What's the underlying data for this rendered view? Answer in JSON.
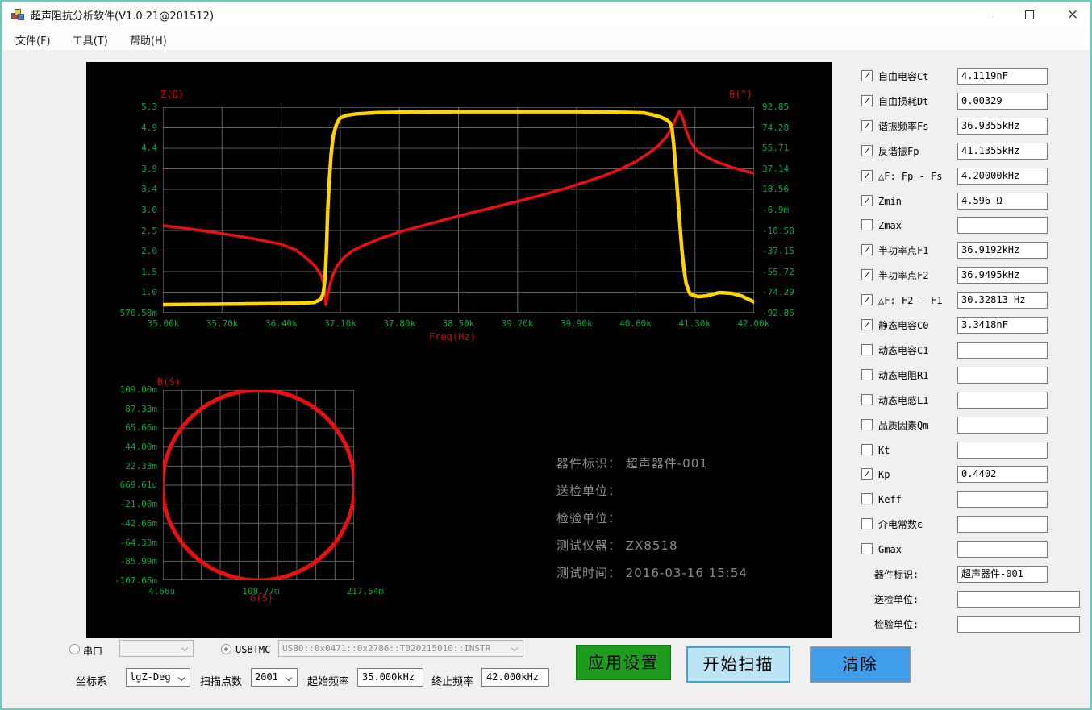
{
  "window": {
    "title": "超声阻抗分析软件(V1.0.21@201512)"
  },
  "menu": [
    "文件(F)",
    "工具(T)",
    "帮助(H)"
  ],
  "colors": {
    "window_border": "#5fcfbe",
    "curve_red": "#e81010",
    "curve_yellow": "#ffd400",
    "tick_green": "#00a83e",
    "axis_label_red": "#d40000",
    "grid_gray": "#606060",
    "button_green": "#1d9b1d",
    "button_light_blue": "#bde4f5",
    "button_blue": "#3f9de9",
    "overlay_gray": "#8c8c8c"
  },
  "results": {
    "rows": [
      {
        "label": "自由电容Ct",
        "value": "4.1119nF",
        "checked": true
      },
      {
        "label": "自由损耗Dt",
        "value": "0.00329",
        "checked": true
      },
      {
        "label": "谐振频率Fs",
        "value": "36.9355kHz",
        "checked": true
      },
      {
        "label": "反谐振Fp",
        "value": "41.1355kHz",
        "checked": true
      },
      {
        "label": "△F: Fp - Fs",
        "value": "4.20000kHz",
        "checked": true
      },
      {
        "label": "Zmin",
        "value": "4.596 Ω",
        "checked": true
      },
      {
        "label": "Zmax",
        "value": "",
        "checked": false
      },
      {
        "label": "半功率点F1",
        "value": "36.9192kHz",
        "checked": true
      },
      {
        "label": "半功率点F2",
        "value": "36.9495kHz",
        "checked": true
      },
      {
        "label": "△F: F2 - F1",
        "value": "30.32813 Hz",
        "checked": true
      },
      {
        "label": "静态电容C0",
        "value": "3.3418nF",
        "checked": true
      },
      {
        "label": "动态电容C1",
        "value": "",
        "checked": false
      },
      {
        "label": "动态电阻R1",
        "value": "",
        "checked": false
      },
      {
        "label": "动态电感L1",
        "value": "",
        "checked": false
      },
      {
        "label": "品质因素Qm",
        "value": "",
        "checked": false
      },
      {
        "label": "Kt",
        "value": "",
        "checked": false
      },
      {
        "label": "Kp",
        "value": "0.4402",
        "checked": true
      },
      {
        "label": "Keff",
        "value": "",
        "checked": false
      },
      {
        "label": "介电常数ε",
        "value": "",
        "checked": false
      },
      {
        "label": "Gmax",
        "value": "",
        "checked": false
      }
    ],
    "device_rows": [
      {
        "label": "器件标识:",
        "value": "超声器件-001",
        "wide": false
      },
      {
        "label": "送检单位:",
        "value": "",
        "wide": true
      },
      {
        "label": "检验单位:",
        "value": "",
        "wide": true
      }
    ]
  },
  "overlay": {
    "lines": [
      "器件标识： 超声器件-001",
      "送检单位：",
      "检验单位：",
      "测试仪器： ZX8518",
      "测试时间： 2016-03-16 15:54"
    ]
  },
  "connection": {
    "serial_label": "串口",
    "serial_selected": false,
    "serial_value": "",
    "usbtmc_label": "USBTMC",
    "usbtmc_selected": true,
    "usbtmc_value": "USB0::0x0471::0x2786::T020215010::INSTR"
  },
  "sweep": {
    "coord_label": "坐标系",
    "coord_value": "lgZ-Deg",
    "points_label": "扫描点数",
    "points_value": "2001",
    "start_label": "起始频率",
    "start_value": "35.000kHz",
    "stop_label": "终止频率",
    "stop_value": "42.000kHz"
  },
  "buttons": {
    "apply": "应用设置",
    "start": "开始扫描",
    "clear": "清除"
  },
  "chart_data": [
    {
      "type": "line",
      "title": "Impedance magnitude and phase vs frequency",
      "xlabel": "Freq(Hz)",
      "ylabel_left": "Z(Ω)",
      "ylabel_right": "θ(°)",
      "x_ticks": [
        "35.00k",
        "35.70k",
        "36.40k",
        "37.10k",
        "37.80k",
        "38.50k",
        "39.20k",
        "39.90k",
        "40.60k",
        "41.30k",
        "42.00k"
      ],
      "y_ticks_left": [
        "5.3",
        "4.9",
        "4.4",
        "3.9",
        "3.4",
        "3.0",
        "2.5",
        "2.0",
        "1.5",
        "1.0",
        "570.58m"
      ],
      "y_ticks_right": [
        "92.85",
        "74.28",
        "55.71",
        "37.14",
        "18.56",
        "-6.9m",
        "-18.58",
        "-37.15",
        "-55.72",
        "-74.29",
        "-92.86"
      ],
      "grid": true,
      "note": "points are [x,y] fractions of plot area, y measured downward; Z dip at Fs=36.9355kHz, peak at Fp=41.1355kHz",
      "series": [
        {
          "name": "Z",
          "color": "#e81010",
          "points": [
            [
              0,
              0.576
            ],
            [
              0.05,
              0.594
            ],
            [
              0.101,
              0.615
            ],
            [
              0.15,
              0.638
            ],
            [
              0.2,
              0.667
            ],
            [
              0.225,
              0.695
            ],
            [
              0.242,
              0.733
            ],
            [
              0.258,
              0.775
            ],
            [
              0.268,
              0.82
            ],
            [
              0.2735,
              0.88
            ],
            [
              0.2754,
              0.961
            ],
            [
              0.278,
              0.92
            ],
            [
              0.282,
              0.87
            ],
            [
              0.2875,
              0.815
            ],
            [
              0.295,
              0.77
            ],
            [
              0.305,
              0.735
            ],
            [
              0.32,
              0.7
            ],
            [
              0.34,
              0.672
            ],
            [
              0.37,
              0.636
            ],
            [
              0.4,
              0.607
            ],
            [
              0.44,
              0.576
            ],
            [
              0.48,
              0.545
            ],
            [
              0.52,
              0.515
            ],
            [
              0.56,
              0.487
            ],
            [
              0.6,
              0.458
            ],
            [
              0.64,
              0.428
            ],
            [
              0.68,
              0.396
            ],
            [
              0.71,
              0.368
            ],
            [
              0.745,
              0.335
            ],
            [
              0.775,
              0.3
            ],
            [
              0.8,
              0.264
            ],
            [
              0.82,
              0.227
            ],
            [
              0.838,
              0.188
            ],
            [
              0.852,
              0.143
            ],
            [
              0.862,
              0.092
            ],
            [
              0.869,
              0.048
            ],
            [
              0.874,
              0.0196
            ],
            [
              0.879,
              0.05
            ],
            [
              0.885,
              0.113
            ],
            [
              0.8925,
              0.168
            ],
            [
              0.9,
              0.2
            ],
            [
              0.906,
              0.218
            ],
            [
              0.92,
              0.242
            ],
            [
              0.934,
              0.263
            ],
            [
              0.96,
              0.29
            ],
            [
              0.98,
              0.307
            ],
            [
              1,
              0.322
            ]
          ]
        },
        {
          "name": "θ",
          "color": "#ffd400",
          "points": [
            [
              0,
              0.961
            ],
            [
              0.06,
              0.9595
            ],
            [
              0.12,
              0.958
            ],
            [
              0.18,
              0.956
            ],
            [
              0.23,
              0.954
            ],
            [
              0.256,
              0.95
            ],
            [
              0.266,
              0.936
            ],
            [
              0.271,
              0.909
            ],
            [
              0.2745,
              0.83
            ],
            [
              0.2765,
              0.7
            ],
            [
              0.2785,
              0.52
            ],
            [
              0.281,
              0.374
            ],
            [
              0.2845,
              0.23
            ],
            [
              0.288,
              0.14
            ],
            [
              0.293,
              0.088
            ],
            [
              0.2987,
              0.0548
            ],
            [
              0.31,
              0.04
            ],
            [
              0.327,
              0.0326
            ],
            [
              0.36,
              0.027
            ],
            [
              0.42,
              0.0235
            ],
            [
              0.5,
              0.022
            ],
            [
              0.6,
              0.022
            ],
            [
              0.7,
              0.022
            ],
            [
              0.75,
              0.0235
            ],
            [
              0.79,
              0.026
            ],
            [
              0.814,
              0.028
            ],
            [
              0.83,
              0.038
            ],
            [
              0.842,
              0.048
            ],
            [
              0.851,
              0.06
            ],
            [
              0.857,
              0.074
            ],
            [
              0.861,
              0.1
            ],
            [
              0.864,
              0.179
            ],
            [
              0.8675,
              0.3
            ],
            [
              0.871,
              0.439
            ],
            [
              0.8745,
              0.57
            ],
            [
              0.878,
              0.7
            ],
            [
              0.8815,
              0.79
            ],
            [
              0.885,
              0.857
            ],
            [
              0.889,
              0.89
            ],
            [
              0.892,
              0.909
            ],
            [
              0.9,
              0.918
            ],
            [
              0.906,
              0.922
            ],
            [
              0.92,
              0.918
            ],
            [
              0.941,
              0.902
            ],
            [
              0.963,
              0.906
            ],
            [
              0.98,
              0.92
            ],
            [
              1,
              0.948
            ]
          ]
        }
      ]
    },
    {
      "type": "line",
      "title": "Admittance circle",
      "xlabel": "G(S)",
      "ylabel": "B(S)",
      "x_ticks": [
        "4.66u",
        "108.77m",
        "217.54m"
      ],
      "y_ticks": [
        "109.00m",
        "87.33m",
        "65.66m",
        "44.00m",
        "22.33m",
        "669.61u",
        "-21.00m",
        "-42.66m",
        "-64.33m",
        "-85.99m",
        "-107.66m"
      ],
      "grid": true,
      "color": "#e81010",
      "circle": {
        "cx": 0.5,
        "cy": 0.5,
        "rx": 0.503,
        "ry": 0.5
      }
    }
  ]
}
